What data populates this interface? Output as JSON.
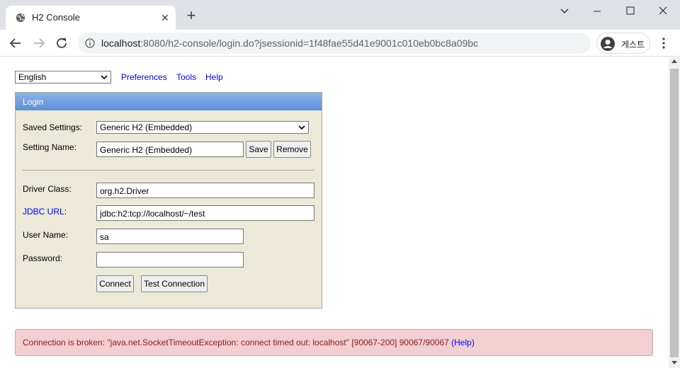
{
  "browser": {
    "tab_title": "H2 Console",
    "url_host": "localhost",
    "url_rest": ":8080/h2-console/login.do?jsessionid=1f48fae55d41e9001c010eb0bc8a09bc",
    "profile_label": "게스트"
  },
  "topnav": {
    "language": "English",
    "links": [
      "Preferences",
      "Tools",
      "Help"
    ]
  },
  "login": {
    "header": "Login",
    "saved_settings_label": "Saved Settings:",
    "saved_settings_value": "Generic H2 (Embedded)",
    "setting_name_label": "Setting Name:",
    "setting_name_value": "Generic H2 (Embedded)",
    "save_label": "Save",
    "remove_label": "Remove",
    "driver_class_label": "Driver Class:",
    "driver_class_value": "org.h2.Driver",
    "jdbc_url_label": "JDBC URL",
    "jdbc_url_colon": ":",
    "jdbc_url_value": "jdbc:h2:tcp://localhost/~/test",
    "user_name_label": "User Name:",
    "user_name_value": "sa",
    "password_label": "Password:",
    "password_value": "",
    "connect_label": "Connect",
    "test_connection_label": "Test Connection"
  },
  "error": {
    "message": "Connection is broken: \"java.net.SocketTimeoutException: connect timed out: localhost\" [90067-200] 90067/90067",
    "help_link": "(Help)"
  },
  "colors": {
    "panel_bg": "#ece9d8",
    "header_blue": "#5e8fd6",
    "error_bg": "#f2cfd1",
    "link": "#0000ff"
  }
}
